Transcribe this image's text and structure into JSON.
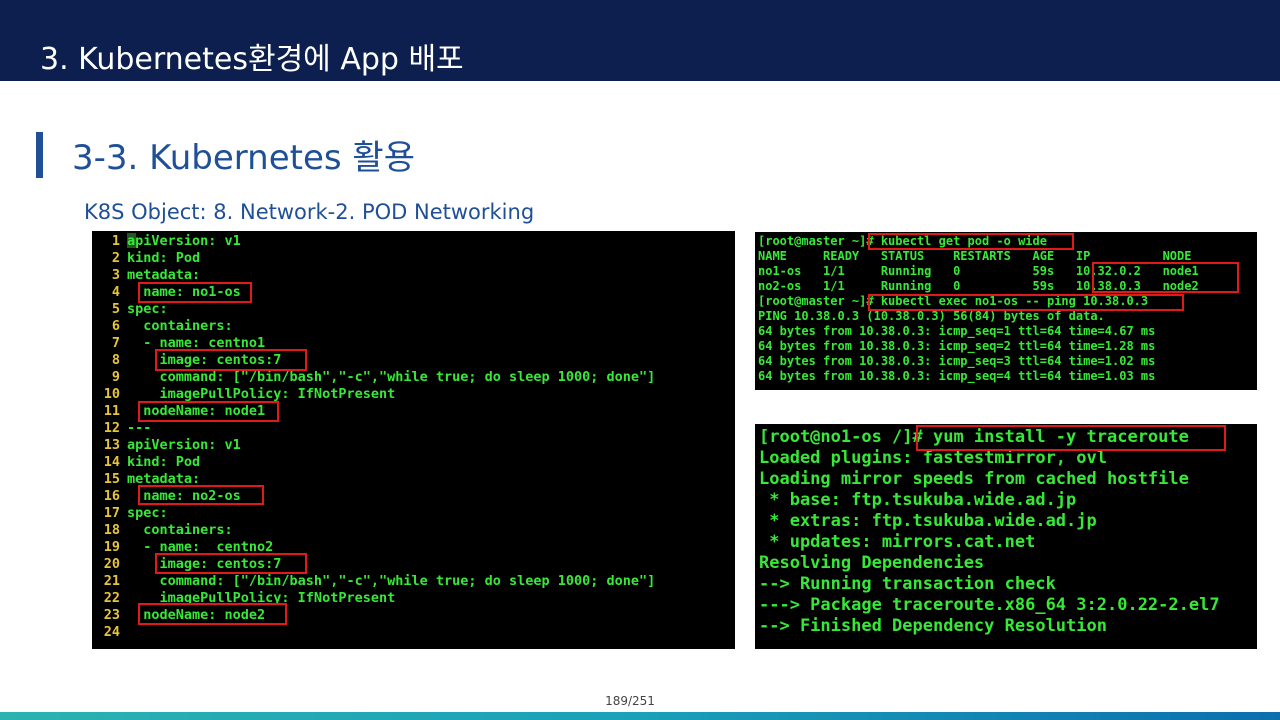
{
  "header": {
    "title": "3.  Kubernetes환경에 App 배포"
  },
  "section": {
    "title": "3-3. Kubernetes 활용",
    "subtitle": "K8S Object: 8. Network-2. POD Networking"
  },
  "yaml_lines": [
    {
      "n": "1",
      "code": "apiVersion: v1"
    },
    {
      "n": "2",
      "code": "kind: Pod"
    },
    {
      "n": "3",
      "code": "metadata:"
    },
    {
      "n": "4",
      "code": "  name: no1-os"
    },
    {
      "n": "5",
      "code": "spec:"
    },
    {
      "n": "6",
      "code": "  containers:"
    },
    {
      "n": "7",
      "code": "  - name: centno1"
    },
    {
      "n": "8",
      "code": "    image: centos:7"
    },
    {
      "n": "9",
      "code": "    command: [\"/bin/bash\",\"-c\",\"while true; do sleep 1000; done\"]"
    },
    {
      "n": "10",
      "code": "    imagePullPolicy: IfNotPresent"
    },
    {
      "n": "11",
      "code": "  nodeName: node1"
    },
    {
      "n": "12",
      "code": "---"
    },
    {
      "n": "13",
      "code": "apiVersion: v1"
    },
    {
      "n": "14",
      "code": "kind: Pod"
    },
    {
      "n": "15",
      "code": "metadata:"
    },
    {
      "n": "16",
      "code": "  name: no2-os"
    },
    {
      "n": "17",
      "code": "spec:"
    },
    {
      "n": "18",
      "code": "  containers:"
    },
    {
      "n": "19",
      "code": "  - name:  centno2"
    },
    {
      "n": "20",
      "code": "    image: centos:7"
    },
    {
      "n": "21",
      "code": "    command: [\"/bin/bash\",\"-c\",\"while true; do sleep 1000; done\"]"
    },
    {
      "n": "22",
      "code": "    imagePullPolicy: IfNotPresent"
    },
    {
      "n": "23",
      "code": "  nodeName: node2"
    },
    {
      "n": "24",
      "code": ""
    }
  ],
  "kubectl_lines": [
    "[root@master ~]# kubectl get pod -o wide",
    "NAME     READY   STATUS    RESTARTS   AGE   IP          NODE",
    "no1-os   1/1     Running   0          59s   10.32.0.2   node1",
    "no2-os   1/1     Running   0          59s   10.38.0.3   node2",
    "[root@master ~]# kubectl exec no1-os -- ping 10.38.0.3",
    "PING 10.38.0.3 (10.38.0.3) 56(84) bytes of data.",
    "64 bytes from 10.38.0.3: icmp_seq=1 ttl=64 time=4.67 ms",
    "64 bytes from 10.38.0.3: icmp_seq=2 ttl=64 time=1.28 ms",
    "64 bytes from 10.38.0.3: icmp_seq=3 ttl=64 time=1.02 ms",
    "64 bytes from 10.38.0.3: icmp_seq=4 ttl=64 time=1.03 ms"
  ],
  "yum_lines": [
    "[root@no1-os /]# yum install -y traceroute",
    "Loaded plugins: fastestmirror, ovl",
    "Loading mirror speeds from cached hostfile",
    " * base: ftp.tsukuba.wide.ad.jp",
    " * extras: ftp.tsukuba.wide.ad.jp",
    " * updates: mirrors.cat.net",
    "Resolving Dependencies",
    "--> Running transaction check",
    "---> Package traceroute.x86_64 3:2.0.22-2.el7",
    "--> Finished Dependency Resolution"
  ],
  "footer": {
    "page": "189/251"
  },
  "colors": {
    "header_bg": "#0d1f4f",
    "accent": "#1f4f96",
    "terminal_text": "#38e838",
    "line_number": "#e8c43d",
    "highlight_box": "#e01919"
  }
}
